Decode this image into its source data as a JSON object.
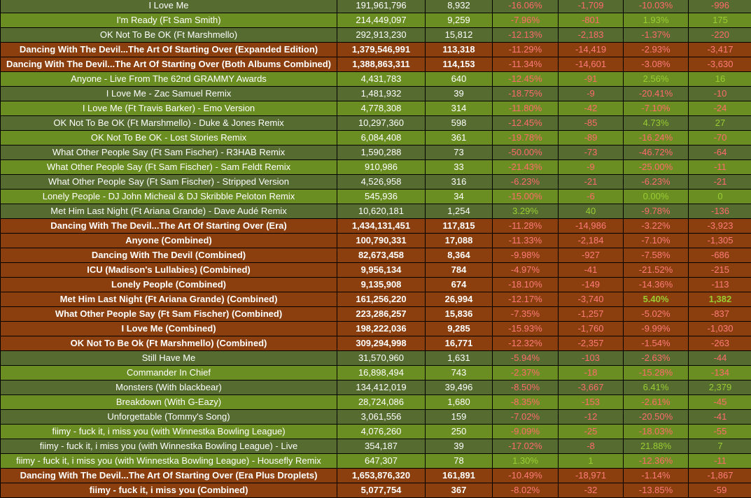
{
  "rows": [
    {
      "t": "a",
      "title": "I Love Me",
      "streams": "191,961,796",
      "daily": "8,932",
      "p1": "-16.06%",
      "d1": "-1,709",
      "p2": "-10.03%",
      "d2": "-996"
    },
    {
      "t": "b",
      "title": "I'm Ready (Ft Sam Smith)",
      "streams": "214,449,097",
      "daily": "9,259",
      "p1": "-7.96%",
      "d1": "-801",
      "p2": "1.93%",
      "d2": "175"
    },
    {
      "t": "a",
      "title": "OK Not To Be OK (Ft Marshmello)",
      "streams": "292,913,230",
      "daily": "15,812",
      "p1": "-12.13%",
      "d1": "-2,183",
      "p2": "-1.37%",
      "d2": "-220"
    },
    {
      "t": "c",
      "title": "Dancing With The Devil...The Art Of Starting Over (Expanded Edition)",
      "streams": "1,379,546,991",
      "daily": "113,318",
      "p1": "-11.29%",
      "d1": "-14,419",
      "p2": "-2.93%",
      "d2": "-3,417"
    },
    {
      "t": "c",
      "title": "Dancing With The Devil...The Art Of Starting Over (Both Albums Combined)",
      "streams": "1,388,863,311",
      "daily": "114,153",
      "p1": "-11.34%",
      "d1": "-14,601",
      "p2": "-3.08%",
      "d2": "-3,630"
    },
    {
      "t": "b",
      "title": "Anyone - Live From The 62nd GRAMMY Awards",
      "streams": "4,431,783",
      "daily": "640",
      "p1": "-12.45%",
      "d1": "-91",
      "p2": "2.56%",
      "d2": "16"
    },
    {
      "t": "a",
      "title": "I Love Me - Zac Samuel Remix",
      "streams": "1,481,932",
      "daily": "39",
      "p1": "-18.75%",
      "d1": "-9",
      "p2": "-20.41%",
      "d2": "-10"
    },
    {
      "t": "b",
      "title": "I Love Me (Ft Travis Barker) - Emo Version",
      "streams": "4,778,308",
      "daily": "314",
      "p1": "-11.80%",
      "d1": "-42",
      "p2": "-7.10%",
      "d2": "-24"
    },
    {
      "t": "a",
      "title": "OK Not To Be OK (Ft Marshmello) - Duke & Jones Remix",
      "streams": "10,297,360",
      "daily": "598",
      "p1": "-12.45%",
      "d1": "-85",
      "p2": "4.73%",
      "d2": "27"
    },
    {
      "t": "b",
      "title": "OK Not To Be OK - Lost Stories Remix",
      "streams": "6,084,408",
      "daily": "361",
      "p1": "-19.78%",
      "d1": "-89",
      "p2": "-16.24%",
      "d2": "-70"
    },
    {
      "t": "a",
      "title": "What Other People Say (Ft Sam Fischer) - R3HAB Remix",
      "streams": "1,590,288",
      "daily": "73",
      "p1": "-50.00%",
      "d1": "-73",
      "p2": "-46.72%",
      "d2": "-64"
    },
    {
      "t": "b",
      "title": "What Other People Say (Ft Sam Fischer) - Sam Feldt Remix",
      "streams": "910,986",
      "daily": "33",
      "p1": "-21.43%",
      "d1": "-9",
      "p2": "-25.00%",
      "d2": "-11"
    },
    {
      "t": "a",
      "title": "What Other People Say (Ft Sam Fischer) - Stripped Version",
      "streams": "4,526,958",
      "daily": "316",
      "p1": "-6.23%",
      "d1": "-21",
      "p2": "-6.23%",
      "d2": "-21"
    },
    {
      "t": "b",
      "title": "Lonely People - DJ John Micheal & DJ Skribble Peloton Remix",
      "streams": "545,936",
      "daily": "34",
      "p1": "-15.00%",
      "d1": "-6",
      "p2": "0.00%",
      "d2": "0"
    },
    {
      "t": "a",
      "title": "Met Him Last Night (Ft Ariana Grande) - Dave Audé Remix",
      "streams": "10,620,181",
      "daily": "1,254",
      "p1": "3.29%",
      "d1": "40",
      "p2": "-9.78%",
      "d2": "-136"
    },
    {
      "t": "c",
      "title": "Dancing With The Devil...The Art Of Starting Over (Era)",
      "streams": "1,434,131,451",
      "daily": "117,815",
      "p1": "-11.28%",
      "d1": "-14,986",
      "p2": "-3.22%",
      "d2": "-3,923"
    },
    {
      "t": "c",
      "title": "Anyone (Combined)",
      "streams": "100,790,331",
      "daily": "17,088",
      "p1": "-11.33%",
      "d1": "-2,184",
      "p2": "-7.10%",
      "d2": "-1,305"
    },
    {
      "t": "c",
      "title": "Dancing With The Devil (Combined)",
      "streams": "82,673,458",
      "daily": "8,364",
      "p1": "-9.98%",
      "d1": "-927",
      "p2": "-7.58%",
      "d2": "-686"
    },
    {
      "t": "c",
      "title": "ICU (Madison's Lullabies) (Combined)",
      "streams": "9,956,134",
      "daily": "784",
      "p1": "-4.97%",
      "d1": "-41",
      "p2": "-21.52%",
      "d2": "-215"
    },
    {
      "t": "c",
      "title": "Lonely People (Combined)",
      "streams": "9,135,908",
      "daily": "674",
      "p1": "-18.10%",
      "d1": "-149",
      "p2": "-14.36%",
      "d2": "-113"
    },
    {
      "t": "c",
      "title": "Met Him Last Night (Ft Ariana Grande) (Combined)",
      "streams": "161,256,220",
      "daily": "26,994",
      "p1": "-12.17%",
      "d1": "-3,740",
      "p2": "5.40%",
      "d2": "1,382"
    },
    {
      "t": "c",
      "title": "What Other People Say (Ft Sam Fischer) (Combined)",
      "streams": "223,286,257",
      "daily": "15,836",
      "p1": "-7.35%",
      "d1": "-1,257",
      "p2": "-5.02%",
      "d2": "-837"
    },
    {
      "t": "c",
      "title": "I Love Me (Combined)",
      "streams": "198,222,036",
      "daily": "9,285",
      "p1": "-15.93%",
      "d1": "-1,760",
      "p2": "-9.99%",
      "d2": "-1,030"
    },
    {
      "t": "c",
      "title": "OK Not To Be Ok (Ft Marshmello) (Combined)",
      "streams": "309,294,998",
      "daily": "16,771",
      "p1": "-12.32%",
      "d1": "-2,357",
      "p2": "-1.54%",
      "d2": "-263"
    },
    {
      "t": "a",
      "title": "Still Have Me",
      "streams": "31,570,960",
      "daily": "1,631",
      "p1": "-5.94%",
      "d1": "-103",
      "p2": "-2.63%",
      "d2": "-44"
    },
    {
      "t": "b",
      "title": "Commander In Chief",
      "streams": "16,898,494",
      "daily": "743",
      "p1": "-2.37%",
      "d1": "-18",
      "p2": "-15.28%",
      "d2": "-134"
    },
    {
      "t": "a",
      "title": "Monsters (With blackbear)",
      "streams": "134,412,019",
      "daily": "39,496",
      "p1": "-8.50%",
      "d1": "-3,667",
      "p2": "6.41%",
      "d2": "2,379"
    },
    {
      "t": "b",
      "title": "Breakdown (With G-Eazy)",
      "streams": "28,724,086",
      "daily": "1,680",
      "p1": "-8.35%",
      "d1": "-153",
      "p2": "-2.61%",
      "d2": "-45"
    },
    {
      "t": "a",
      "title": "Unforgettable (Tommy's Song)",
      "streams": "3,061,556",
      "daily": "159",
      "p1": "-7.02%",
      "d1": "-12",
      "p2": "-20.50%",
      "d2": "-41"
    },
    {
      "t": "b",
      "title": "fiimy - fuck it, i miss you (with Winnestka Bowling League)",
      "streams": "4,076,260",
      "daily": "250",
      "p1": "-9.09%",
      "d1": "-25",
      "p2": "-18.03%",
      "d2": "-55"
    },
    {
      "t": "a",
      "title": "fiimy - fuck it, i miss you (with Winnestka Bowling League) - Live",
      "streams": "354,187",
      "daily": "39",
      "p1": "-17.02%",
      "d1": "-8",
      "p2": "21.88%",
      "d2": "7"
    },
    {
      "t": "b",
      "title": "fiimy - fuck it, i miss you (with Winnestka Bowling League) - Housefly Remix",
      "streams": "647,307",
      "daily": "78",
      "p1": "1.30%",
      "d1": "1",
      "p2": "-12.36%",
      "d2": "-11"
    },
    {
      "t": "c",
      "title": "Dancing With The Devil...The Art Of Starting Over (Era Plus Droplets)",
      "streams": "1,653,876,320",
      "daily": "161,891",
      "p1": "-10.49%",
      "d1": "-18,971",
      "p2": "-1.14%",
      "d2": "-1,867"
    },
    {
      "t": "c",
      "title": "fiimy - fuck it, i miss you (Combined)",
      "streams": "5,077,754",
      "daily": "367",
      "p1": "-8.02%",
      "d1": "-32",
      "p2": "-13.85%",
      "d2": "-59"
    }
  ],
  "colors": {
    "row_dark_olive": "#556b2f",
    "row_olive": "#6b8e23",
    "row_combined_brown": "#8b3f0e",
    "negative_text": "#ff6b6b",
    "positive_text": "#9acd32"
  }
}
